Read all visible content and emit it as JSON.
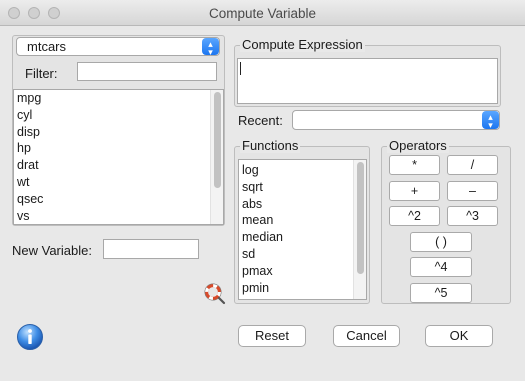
{
  "window": {
    "title": "Compute Variable"
  },
  "dataset": {
    "selected": "mtcars"
  },
  "filter": {
    "label": "Filter:",
    "value": ""
  },
  "variables": [
    "mpg",
    "cyl",
    "disp",
    "hp",
    "drat",
    "wt",
    "qsec",
    "vs"
  ],
  "new_variable": {
    "label": "New Variable:",
    "value": ""
  },
  "compute_expression": {
    "legend": "Compute Expression",
    "value": ""
  },
  "recent": {
    "label": "Recent:",
    "value": ""
  },
  "functions": {
    "legend": "Functions",
    "items": [
      "log",
      "sqrt",
      "abs",
      "mean",
      "median",
      "sd",
      "pmax",
      "pmin"
    ]
  },
  "operators": {
    "legend": "Operators",
    "multiply": "*",
    "divide": "/",
    "plus": "+",
    "minus": "–",
    "square": "^2",
    "cube": "^3",
    "parens": "( )",
    "pow4": "^4",
    "pow5": "^5"
  },
  "buttons": {
    "reset": "Reset",
    "cancel": "Cancel",
    "ok": "OK"
  },
  "icons": {
    "info": "info-icon",
    "lifebuoy": "lifebuoy-help-icon"
  }
}
